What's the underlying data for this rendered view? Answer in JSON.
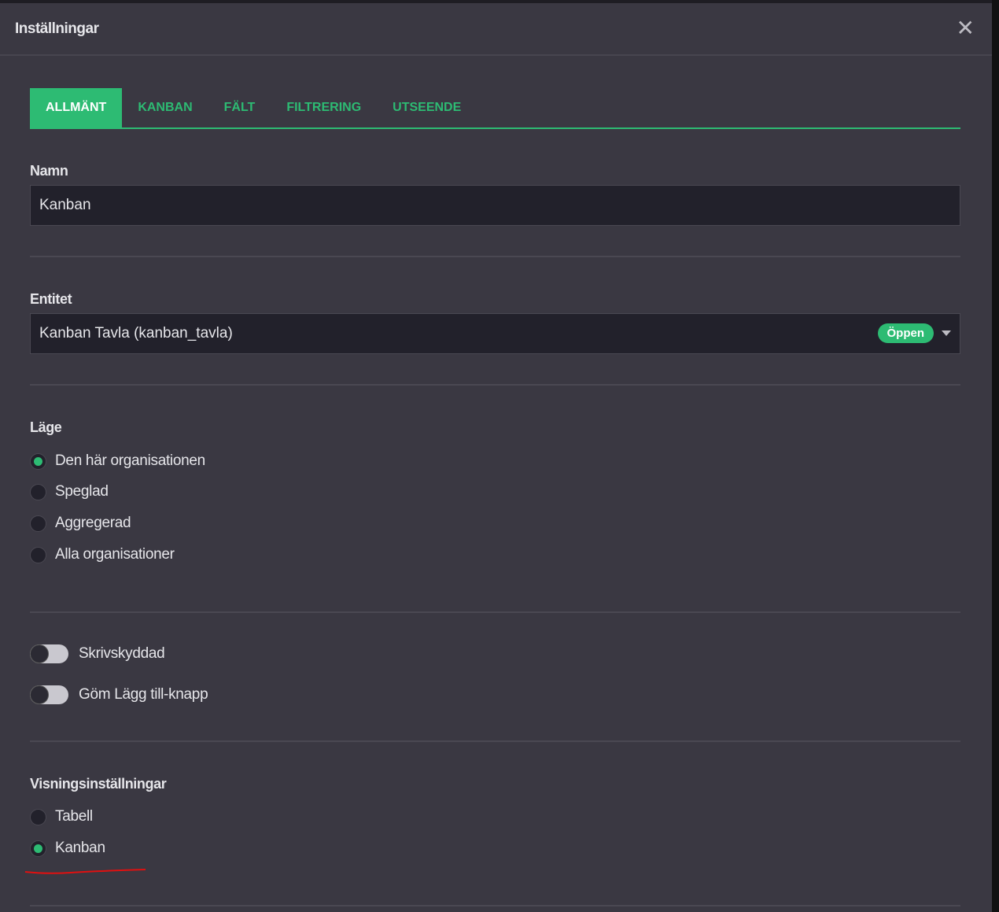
{
  "dialog": {
    "title": "Inställningar",
    "close_icon": "close-icon"
  },
  "tabs": [
    {
      "label": "ALLMÄNT",
      "active": true
    },
    {
      "label": "KANBAN"
    },
    {
      "label": "FÄLT"
    },
    {
      "label": "FILTRERING"
    },
    {
      "label": "UTSEENDE"
    }
  ],
  "name": {
    "label": "Namn",
    "value": "Kanban"
  },
  "entity": {
    "label": "Entitet",
    "value": "Kanban Tavla (kanban_tavla)",
    "badge": "Öppen"
  },
  "mode": {
    "label": "Läge",
    "options": [
      "Den här organisationen",
      "Speglad",
      "Aggregerad",
      "Alla organisationer"
    ],
    "selected": 0
  },
  "toggles": [
    {
      "label": "Skrivskyddad",
      "on": false
    },
    {
      "label": "Göm Lägg till-knapp",
      "on": false
    }
  ],
  "display": {
    "label": "Visningsinställningar",
    "options": [
      "Tabell",
      "Kanban"
    ],
    "selected": 1
  },
  "colors": {
    "accent": "#2dbb73",
    "background": "#3a3842",
    "input": "#22212b",
    "annotation": "#e01010"
  }
}
